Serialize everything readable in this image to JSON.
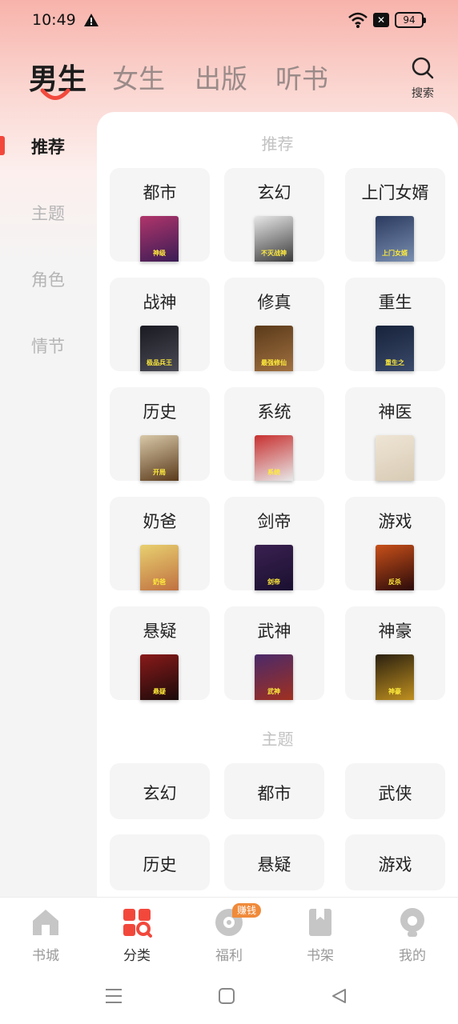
{
  "status_bar": {
    "time": "10:49",
    "battery": "94"
  },
  "top_tabs": [
    {
      "label": "男生",
      "active": true
    },
    {
      "label": "女生",
      "active": false
    },
    {
      "label": "出版",
      "active": false
    },
    {
      "label": "听书",
      "active": false
    }
  ],
  "search": {
    "label": "搜索"
  },
  "sidebar": [
    {
      "label": "推荐",
      "active": true
    },
    {
      "label": "主题",
      "active": false
    },
    {
      "label": "角色",
      "active": false
    },
    {
      "label": "情节",
      "active": false
    }
  ],
  "recommend": {
    "title": "推荐",
    "categories": [
      {
        "label": "都市",
        "cover_title": "神级",
        "colors": [
          "#b0356b",
          "#3a1c55"
        ]
      },
      {
        "label": "玄幻",
        "cover_title": "不灭战神",
        "colors": [
          "#e7e7e7",
          "#3b3b3b"
        ]
      },
      {
        "label": "上门女婿",
        "cover_title": "上门女婿",
        "colors": [
          "#2b3a60",
          "#7a8fb0"
        ]
      },
      {
        "label": "战神",
        "cover_title": "极品兵王",
        "colors": [
          "#1a1a22",
          "#4a4a55"
        ]
      },
      {
        "label": "修真",
        "cover_title": "最强修仙",
        "colors": [
          "#5a3a1a",
          "#a07040"
        ]
      },
      {
        "label": "重生",
        "cover_title": "重生之",
        "colors": [
          "#17223a",
          "#3a4a6a"
        ]
      },
      {
        "label": "历史",
        "cover_title": "开局",
        "colors": [
          "#d8c8a8",
          "#5a3a1a"
        ]
      },
      {
        "label": "系统",
        "cover_title": "系统",
        "colors": [
          "#c83030",
          "#e8e8e8"
        ]
      },
      {
        "label": "神医",
        "cover_title": "",
        "colors": [
          "#efe5d5",
          "#d8cbb5"
        ]
      },
      {
        "label": "奶爸",
        "cover_title": "奶爸",
        "colors": [
          "#e8d070",
          "#c07040"
        ]
      },
      {
        "label": "剑帝",
        "cover_title": "剑帝",
        "colors": [
          "#3a2050",
          "#1a1030"
        ]
      },
      {
        "label": "游戏",
        "cover_title": "反杀",
        "colors": [
          "#c8501a",
          "#2a0a0a"
        ]
      },
      {
        "label": "悬疑",
        "cover_title": "悬疑",
        "colors": [
          "#8a1a1a",
          "#1a0a0a"
        ]
      },
      {
        "label": "武神",
        "cover_title": "武神",
        "colors": [
          "#4a2a6a",
          "#a03020"
        ]
      },
      {
        "label": "神豪",
        "cover_title": "神豪",
        "colors": [
          "#2a2010",
          "#c09020"
        ]
      }
    ]
  },
  "themes": {
    "title": "主题",
    "items": [
      {
        "label": "玄幻"
      },
      {
        "label": "都市"
      },
      {
        "label": "武侠"
      },
      {
        "label": "历史"
      },
      {
        "label": "悬疑"
      },
      {
        "label": "游戏"
      }
    ]
  },
  "bottom_nav": [
    {
      "label": "书城",
      "icon": "home-icon",
      "active": false
    },
    {
      "label": "分类",
      "icon": "category-icon",
      "active": true
    },
    {
      "label": "福利",
      "icon": "gift-icon",
      "active": false
    },
    {
      "label": "书架",
      "icon": "bookshelf-icon",
      "active": false
    },
    {
      "label": "我的",
      "icon": "profile-icon",
      "active": false
    }
  ],
  "welfare_badge": "赚钱",
  "colors": {
    "accent": "#f2483c",
    "badge": "#f08a3a"
  }
}
